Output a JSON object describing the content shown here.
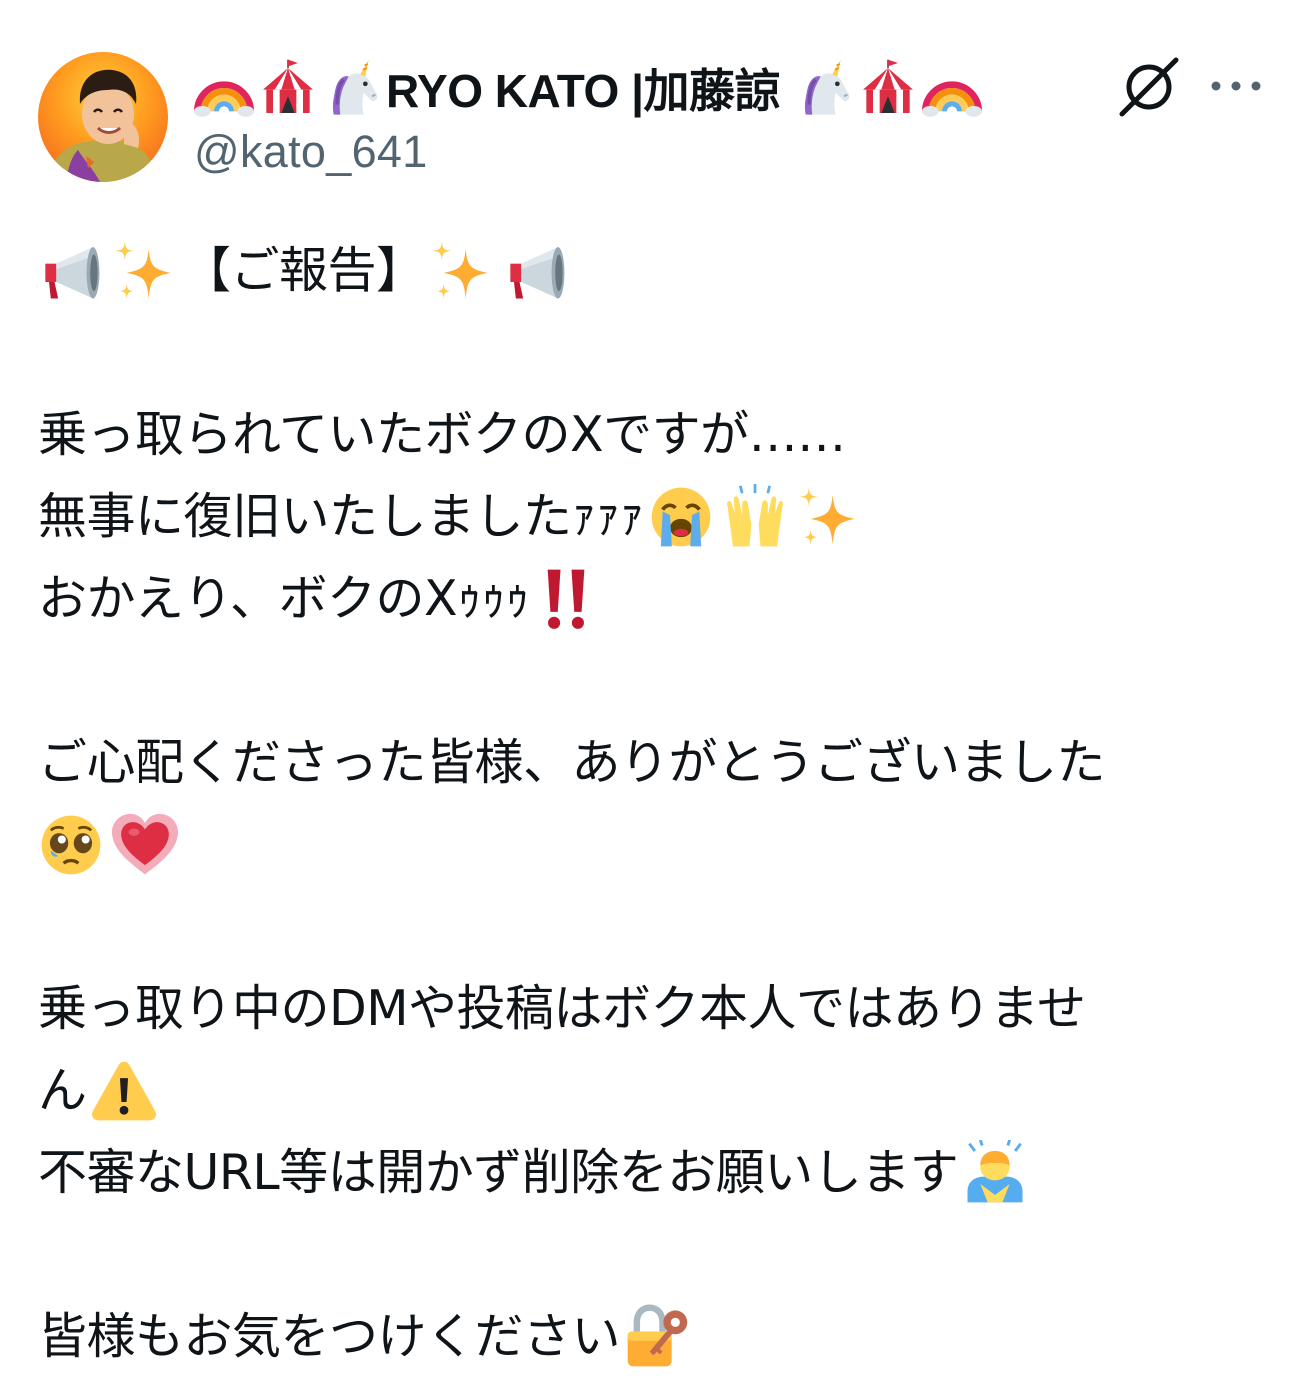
{
  "user": {
    "display_name": "RYO KATO |加藤諒",
    "name_prefix_icons": [
      "rainbow-icon",
      "circus-tent-icon",
      "unicorn-icon"
    ],
    "name_suffix_icons": [
      "unicorn-icon",
      "circus-tent-icon",
      "rainbow-icon"
    ],
    "handle": "@kato_641"
  },
  "actions": {
    "grok_icon": "grok-icon",
    "more_label": "•••"
  },
  "tweet": {
    "line1": {
      "text": "【ご報告】",
      "icons_before": [
        "megaphone-icon",
        "sparkles-icon"
      ],
      "icons_after": [
        "sparkles-icon",
        "megaphone-icon"
      ]
    },
    "line2": "乗っ取られていたボクのXですが……",
    "line3": {
      "text": "無事に復旧いたしましたｧｧｧ",
      "icons_after": [
        "loudly-crying-face-icon",
        "raising-hands-icon",
        "sparkles-icon"
      ]
    },
    "line4": {
      "text": "おかえり、ボクのXｩｩｩ",
      "icons_after": [
        "double-exclamation-icon"
      ]
    },
    "line5": "ご心配くださった皆様、ありがとうございました",
    "line6": {
      "icons": [
        "pleading-face-icon",
        "growing-heart-icon"
      ]
    },
    "line7": "乗っ取り中のDMや投稿はボク本人ではありませ",
    "line8": {
      "text": "ん",
      "icons_after": [
        "warning-icon"
      ]
    },
    "line9": {
      "text": "不審なURL等は開かず削除をお願いします",
      "icons_after": [
        "man-bowing-icon"
      ]
    },
    "line10": {
      "text": "皆様もお気をつけください",
      "icons_after": [
        "locked-with-key-icon"
      ]
    }
  },
  "colors": {
    "text": "#0f1419",
    "secondary": "#536471",
    "background": "#ffffff"
  }
}
